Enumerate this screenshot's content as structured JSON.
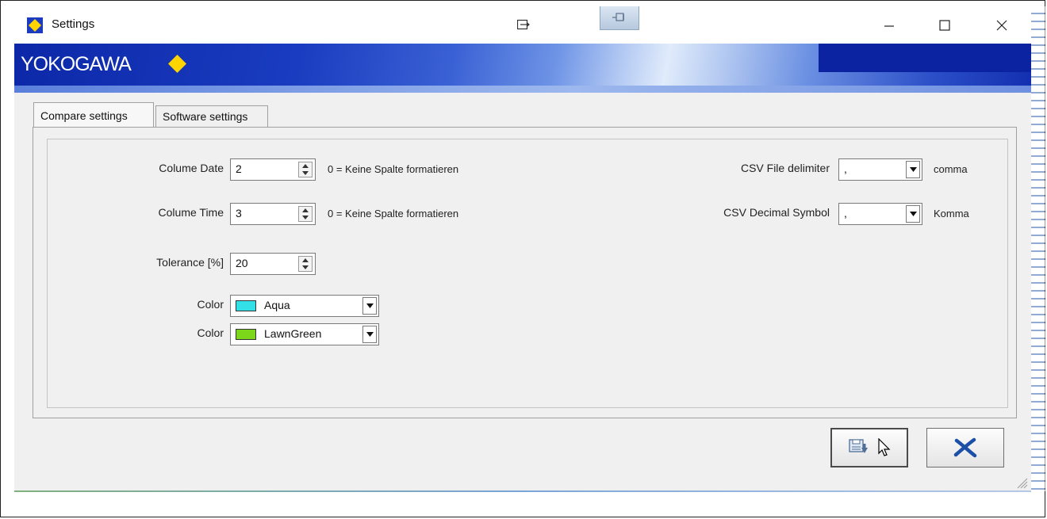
{
  "window": {
    "title": "Settings",
    "brand": "YOKOGAWA",
    "brand_color": "#0c28a8",
    "logo_diamond_color": "#ffd400",
    "icons": [
      "snap-layout-icon",
      "pin-icon",
      "minimize-icon",
      "maximize-icon",
      "close-icon"
    ]
  },
  "tabs": [
    {
      "label": "Compare settings",
      "active": true
    },
    {
      "label": "Software settings",
      "active": false
    }
  ],
  "compare": {
    "colume_date": {
      "label": "Colume Date",
      "value": "2",
      "hint": "0 = Keine Spalte formatieren"
    },
    "colume_time": {
      "label": "Colume Time",
      "value": "3",
      "hint": "0 = Keine Spalte formatieren"
    },
    "tolerance": {
      "label": "Tolerance [%]",
      "value": "20"
    },
    "color1": {
      "label": "Color",
      "value": "Aqua",
      "swatch": "#33e0e8"
    },
    "color2": {
      "label": "Color",
      "value": "LawnGreen",
      "swatch": "#7cd71a"
    },
    "csv_delimiter": {
      "label": "CSV File delimiter",
      "value": ",",
      "note": "comma"
    },
    "csv_decimal": {
      "label": "CSV Decimal Symbol",
      "value": ",",
      "note": "Komma"
    }
  },
  "buttons": {
    "save": {
      "icon": "save-icon"
    },
    "cancel": {
      "icon": "cancel-x-icon",
      "color": "#1c4fa8"
    }
  }
}
